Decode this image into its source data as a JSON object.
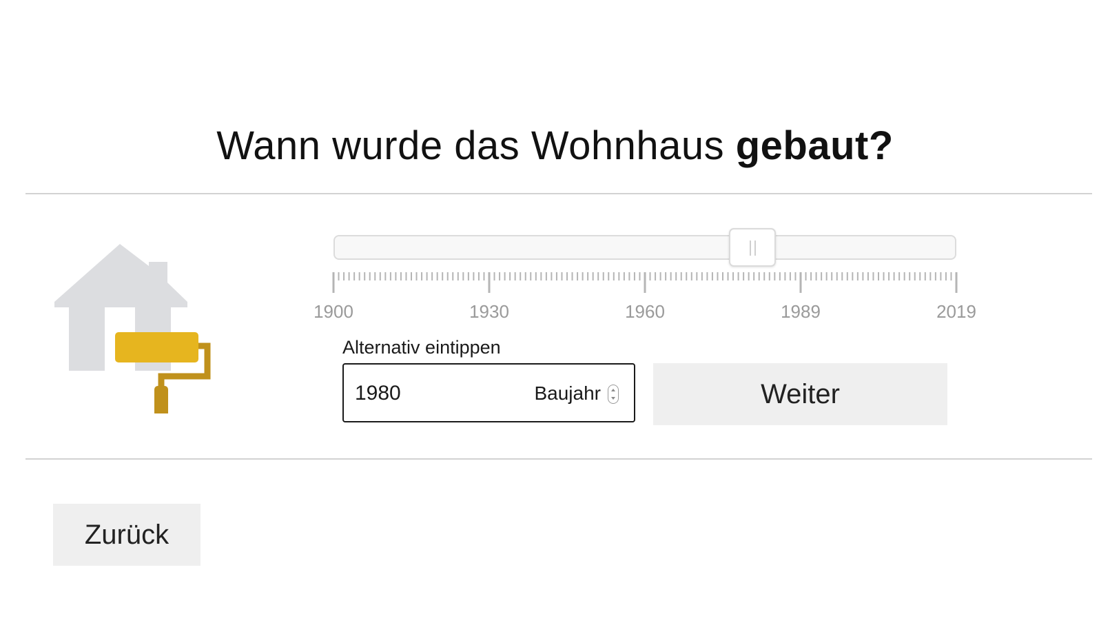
{
  "question": {
    "prefix": "Wann wurde das Wohnhaus",
    "emphasis": "gebaut?"
  },
  "icon": {
    "name": "house-paint-roller-icon",
    "house_color": "#dcdde0",
    "roller_color": "#e6b51f",
    "handle_color": "#c0911c"
  },
  "slider": {
    "min": 1900,
    "max": 2019,
    "value": 1980,
    "tick_labels": [
      "1900",
      "1930",
      "1960",
      "1989",
      "2019"
    ]
  },
  "alternative": {
    "label": "Alternativ eintippen",
    "value": "1980",
    "unit": "Baujahr"
  },
  "buttons": {
    "next": "Weiter",
    "back": "Zurück"
  }
}
